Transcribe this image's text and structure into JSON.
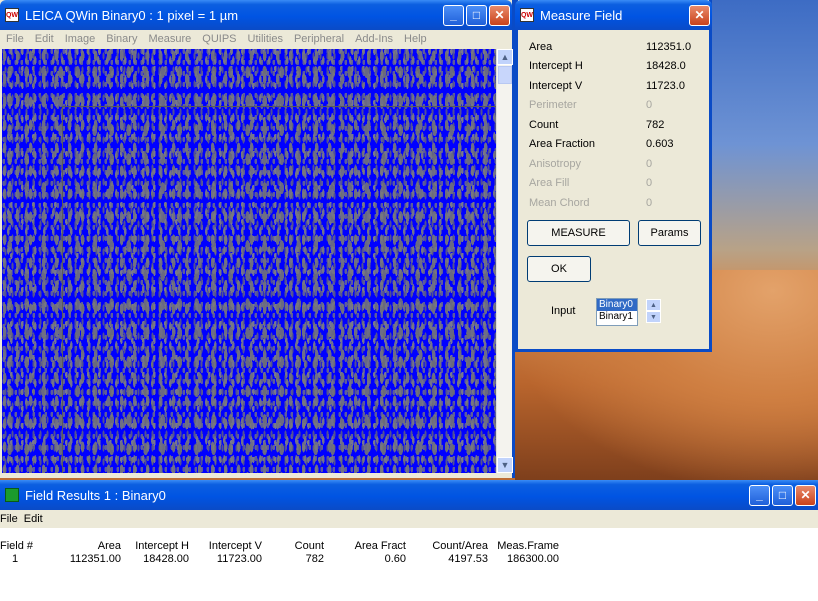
{
  "main_window": {
    "title": "LEICA QWin   Binary0  :  1 pixel = 1 µm",
    "icon_label": "QW",
    "menu": [
      "File",
      "Edit",
      "Image",
      "Binary",
      "Measure",
      "QUIPS",
      "Utilities",
      "Peripheral",
      "Add-Ins",
      "Help"
    ]
  },
  "measure_field": {
    "title": "Measure Field",
    "rows": [
      {
        "label": "Area",
        "value": "112351.0",
        "enabled": true
      },
      {
        "label": "Intercept H",
        "value": "18428.0",
        "enabled": true
      },
      {
        "label": "Intercept V",
        "value": "11723.0",
        "enabled": true
      },
      {
        "label": "Perimeter",
        "value": "0",
        "enabled": false
      },
      {
        "label": "Count",
        "value": "782",
        "enabled": true
      },
      {
        "label": "Area Fraction",
        "value": "0.603",
        "enabled": true
      },
      {
        "label": "Anisotropy",
        "value": "0",
        "enabled": false
      },
      {
        "label": "Area Fill",
        "value": "0",
        "enabled": false
      },
      {
        "label": "Mean Chord",
        "value": "0",
        "enabled": false
      }
    ],
    "measure_button": "MEASURE",
    "params_button": "Params",
    "ok_button": "OK",
    "input_label": "Input",
    "input_options": [
      "Binary0",
      "Binary1"
    ],
    "input_selected": "Binary0"
  },
  "field_results": {
    "title": "Field Results 1 : Binary0",
    "menu": [
      "File",
      "Edit"
    ],
    "headers": [
      "Field #",
      "Area",
      "Intercept H",
      "Intercept V",
      "Count",
      "Area Fract",
      "Count/Area",
      "Meas.Frame"
    ],
    "rows": [
      [
        "1",
        "112351.00",
        "18428.00",
        "11723.00",
        "782",
        "0.60",
        "4197.53",
        "186300.00"
      ]
    ]
  },
  "window_controls": {
    "minimize": "_",
    "maximize": "□",
    "close": "✕"
  },
  "colors": {
    "binary_overlay": "#0000ff",
    "title_bar": "#0054e3",
    "close_button": "#c9421c"
  }
}
